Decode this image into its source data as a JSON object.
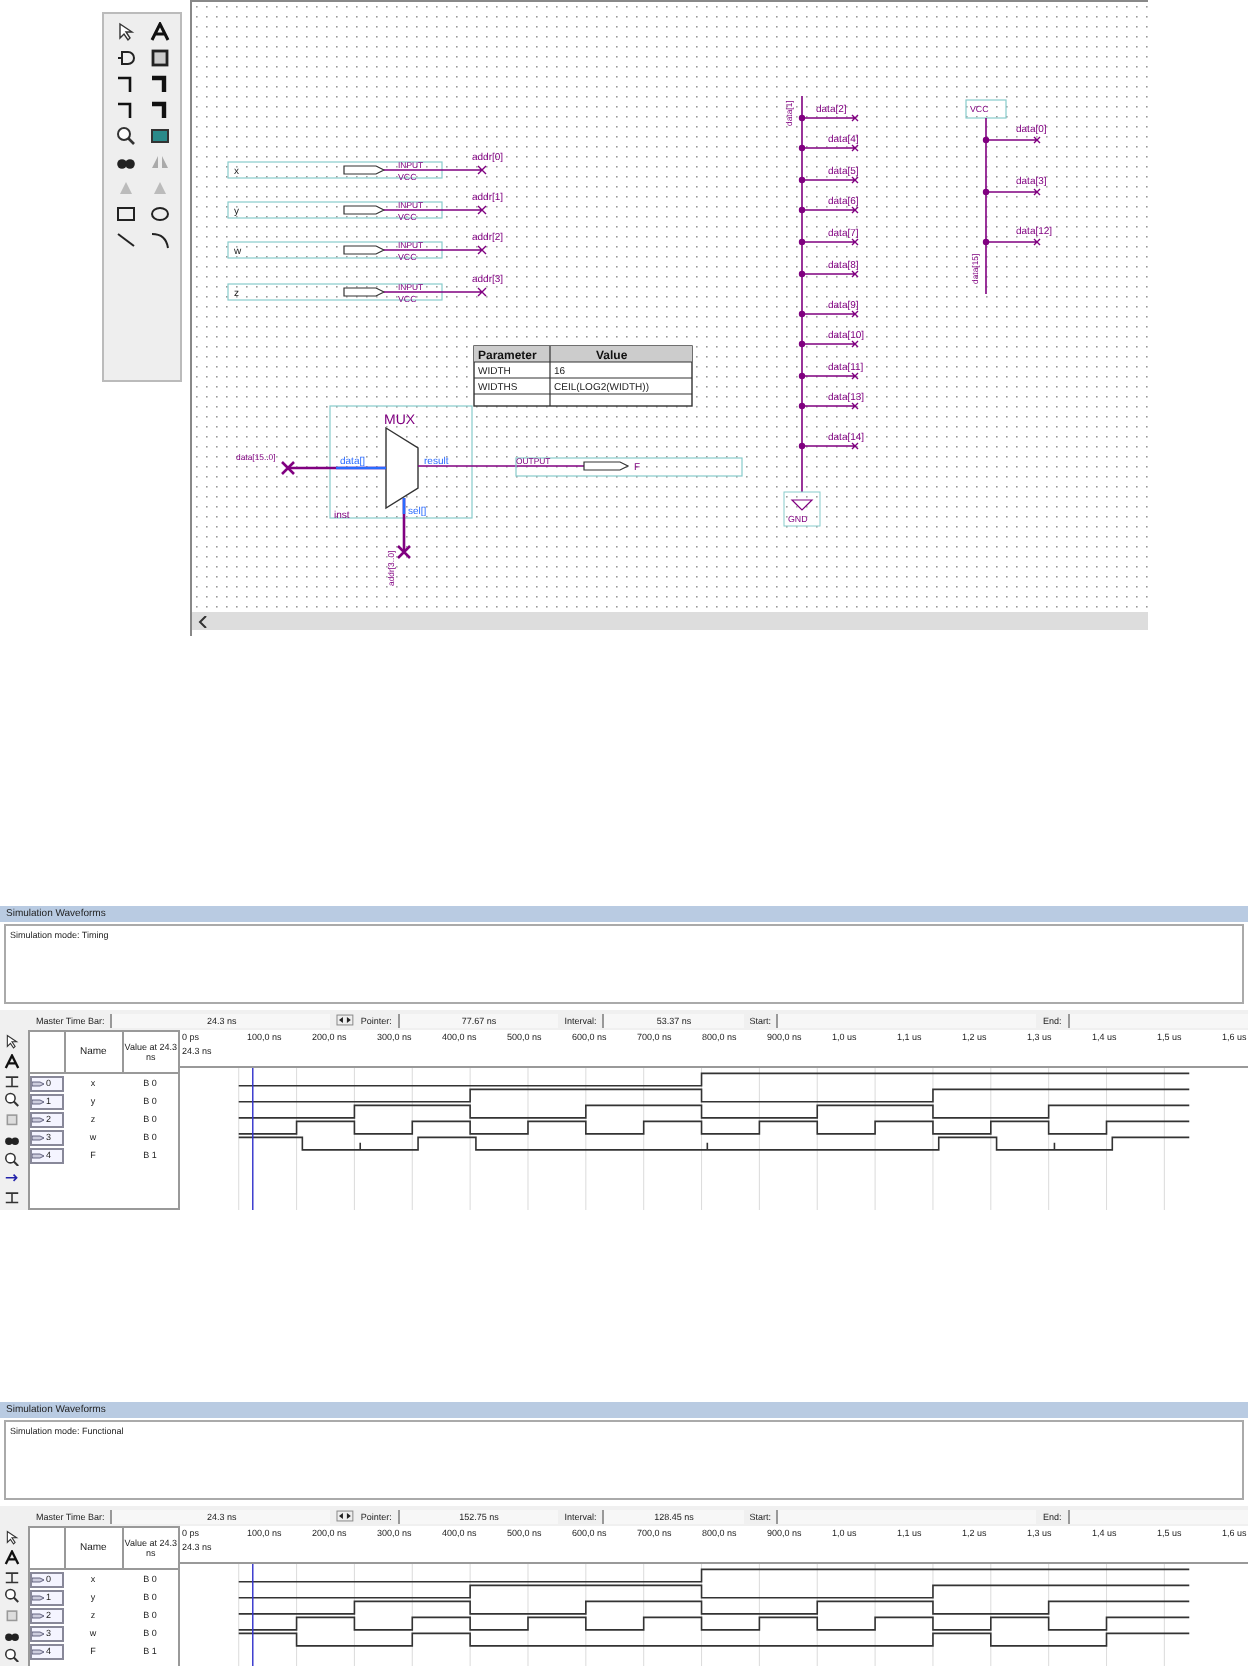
{
  "schematic": {
    "inputs": [
      {
        "name": "x",
        "type": "INPUT",
        "supply": "VCC",
        "wire": "addr[0]"
      },
      {
        "name": "y",
        "type": "INPUT",
        "supply": "VCC",
        "wire": "addr[1]"
      },
      {
        "name": "w",
        "type": "INPUT",
        "supply": "VCC",
        "wire": "addr[2]"
      },
      {
        "name": "z",
        "type": "INPUT",
        "supply": "VCC",
        "wire": "addr[3]"
      }
    ],
    "parameters": {
      "columns": [
        "Parameter",
        "Value"
      ],
      "rows": [
        [
          "WIDTH",
          "16"
        ],
        [
          "WIDTHS",
          "CEIL(LOG2(WIDTH))"
        ]
      ]
    },
    "mux": {
      "title": "MUX",
      "data_port": "data[]",
      "result_port": "result",
      "sel_port": "sel[]",
      "instance": "inst",
      "data_wire": "data[15..0]",
      "sel_wire": "addr[3..0]"
    },
    "output": {
      "type": "OUTPUT",
      "name": "F"
    },
    "gnd_bus": {
      "bus": "data[1]",
      "taps": [
        "data[2]",
        "data[4]",
        "data[5]",
        "data[6]",
        "data[7]",
        "data[8]",
        "data[9]",
        "data[10]",
        "data[11]",
        "data[13]",
        "data[14]"
      ],
      "symbol": "GND"
    },
    "vcc_bus": {
      "symbol": "VCC",
      "taps": [
        "data[0]",
        "data[3]",
        "data[12]"
      ],
      "bus": "data[15]"
    }
  },
  "panels": [
    {
      "title": "Simulation Waveforms",
      "mode": "Simulation mode: Timing",
      "time_bar": {
        "master_label": "Master Time Bar:",
        "master": "24.3 ns",
        "pointer_label": "Pointer:",
        "pointer": "77.67 ns",
        "interval_label": "Interval:",
        "interval": "53.37 ns",
        "start_label": "Start:",
        "end_label": "End:"
      },
      "columns": [
        "Name",
        "Value at 24.3 ns"
      ],
      "cursor": "24.3 ns",
      "ticks": [
        "0 ps",
        "100,0 ns",
        "200,0 ns",
        "300,0 ns",
        "400,0 ns",
        "500,0 ns",
        "600,0 ns",
        "700,0 ns",
        "800,0 ns",
        "900,0 ns",
        "1,0 us",
        "1,1 us",
        "1,2 us",
        "1,3 us",
        "1,4 us",
        "1,5 us",
        "1,6 us"
      ],
      "signals": [
        {
          "index": "0",
          "name": "x",
          "value": "B 0"
        },
        {
          "index": "1",
          "name": "y",
          "value": "B 0"
        },
        {
          "index": "2",
          "name": "z",
          "value": "B 0"
        },
        {
          "index": "3",
          "name": "w",
          "value": "B 0"
        },
        {
          "index": "4",
          "name": "F",
          "value": "B 1"
        }
      ]
    },
    {
      "title": "Simulation Waveforms",
      "mode": "Simulation mode: Functional",
      "time_bar": {
        "master_label": "Master Time Bar:",
        "master": "24.3 ns",
        "pointer_label": "Pointer:",
        "pointer": "152.75 ns",
        "interval_label": "Interval:",
        "interval": "128.45 ns",
        "start_label": "Start:",
        "end_label": "End:"
      },
      "columns": [
        "Name",
        "Value at 24.3 ns"
      ],
      "cursor": "24.3 ns",
      "ticks": [
        "0 ps",
        "100,0 ns",
        "200,0 ns",
        "300,0 ns",
        "400,0 ns",
        "500,0 ns",
        "600,0 ns",
        "700,0 ns",
        "800,0 ns",
        "900,0 ns",
        "1,0 us",
        "1,1 us",
        "1,2 us",
        "1,3 us",
        "1,4 us",
        "1,5 us",
        "1,6 us"
      ],
      "signals": [
        {
          "index": "0",
          "name": "x",
          "value": "B 0"
        },
        {
          "index": "1",
          "name": "y",
          "value": "B 0"
        },
        {
          "index": "2",
          "name": "z",
          "value": "B 0"
        },
        {
          "index": "3",
          "name": "w",
          "value": "B 0"
        },
        {
          "index": "4",
          "name": "F",
          "value": "B 1"
        }
      ]
    }
  ]
}
